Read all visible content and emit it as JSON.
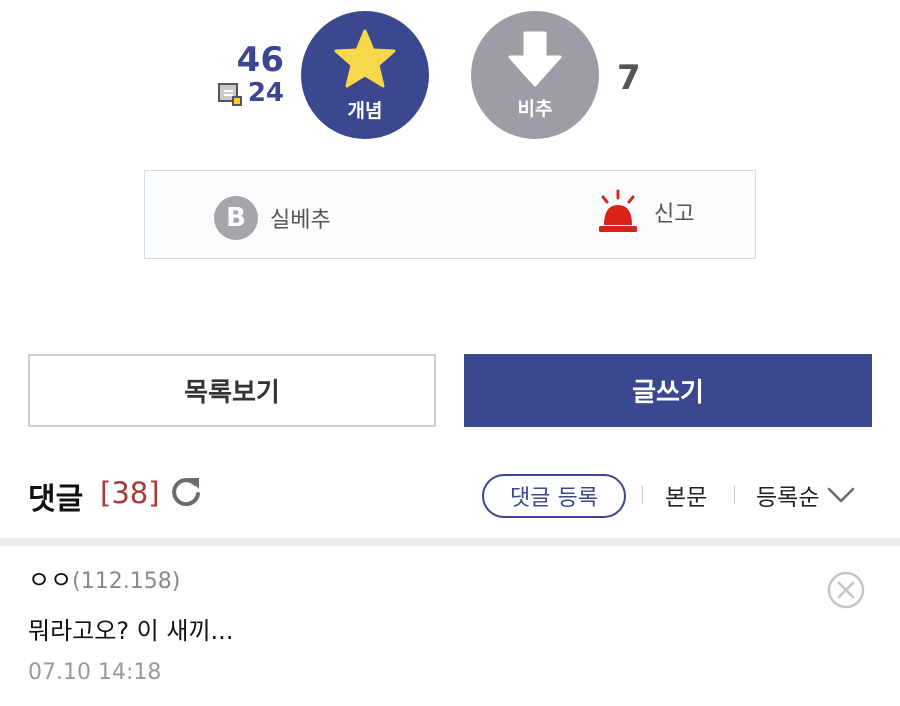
{
  "vote": {
    "up_count": "46",
    "fix_count": "24",
    "up_label": "개념",
    "down_label": "비추",
    "down_count": "7",
    "up_color": "#3b4890",
    "down_color": "#9d9da6"
  },
  "report_box": {
    "best_icon_text": "B",
    "best_label": "실베추",
    "report_label": "신고"
  },
  "actions": {
    "list_label": "목록보기",
    "write_label": "글쓰기"
  },
  "comments_header": {
    "title": "댓글",
    "count": "[38]",
    "register_label": "댓글 등록",
    "body_label": "본문",
    "sort_label": "등록순"
  },
  "comments": [
    {
      "author": "ㅇㅇ",
      "ip": "(112.158)",
      "text": "뭐라고오? 이 새끼...",
      "date": "07.10 14:18"
    }
  ],
  "icons": {
    "star": "star-icon",
    "down_arrow": "arrow-down-icon",
    "fix": "fixed-nick-icon",
    "siren": "siren-icon",
    "refresh": "refresh-icon",
    "chevron": "chevron-down-icon",
    "delete": "delete-circle-icon"
  },
  "colors": {
    "brand": "#3b4890",
    "comment_count": "#a33a3a",
    "siren": "#d9231a"
  }
}
